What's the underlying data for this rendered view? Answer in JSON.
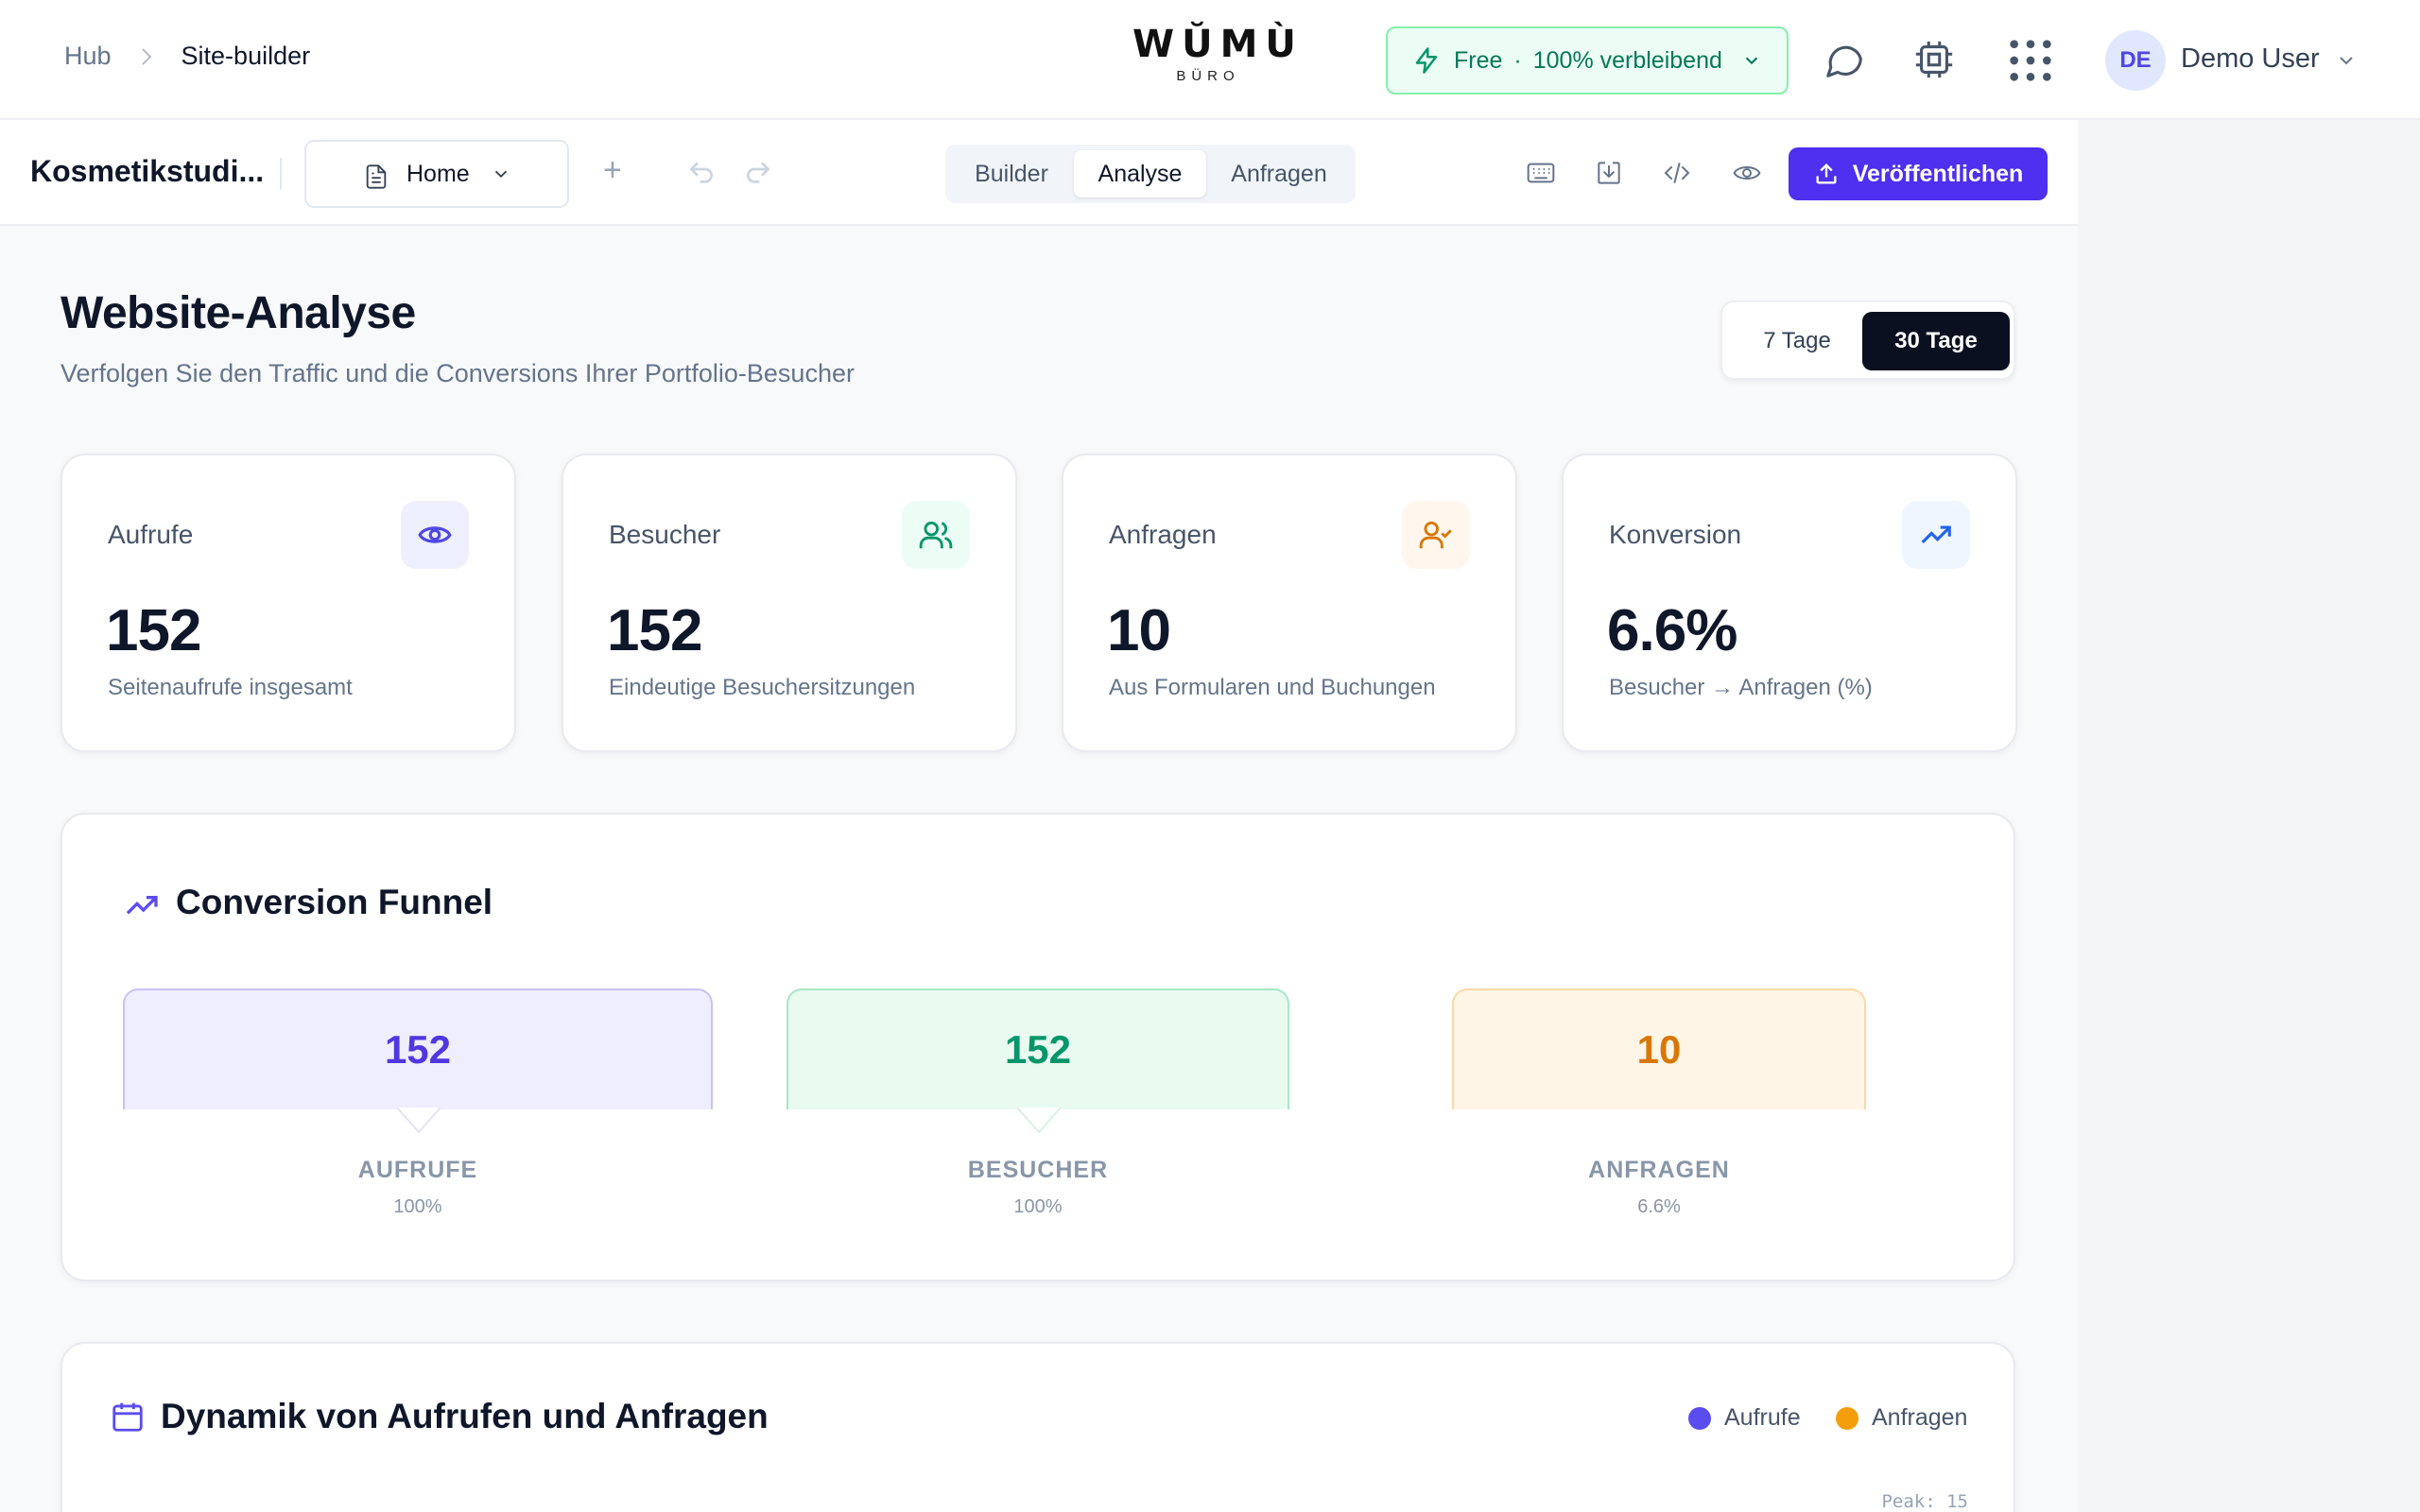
{
  "header": {
    "breadcrumb": {
      "root": "Hub",
      "current": "Site-builder"
    },
    "logo": {
      "main": "WŬMÙ",
      "sub": "BÜRO"
    },
    "plan": {
      "name": "Free",
      "separator": "·",
      "status": "100% verbleibend"
    },
    "user": {
      "initials": "DE",
      "name": "Demo User"
    }
  },
  "toolbar": {
    "project_name": "Kosmetikstudi...",
    "page_select": "Home",
    "add_label": "+",
    "tabs": [
      "Builder",
      "Analyse",
      "Anfragen"
    ],
    "active_tab": "Analyse",
    "publish_label": "Veröffentlichen"
  },
  "main": {
    "title": "Website-Analyse",
    "subtitle": "Verfolgen Sie den Traffic und die Conversions Ihrer Portfolio-Besucher",
    "range": {
      "options": [
        "7 Tage",
        "30 Tage"
      ],
      "selected": "30 Tage"
    },
    "kpis": [
      {
        "label": "Aufrufe",
        "value": "152",
        "desc": "Seitenaufrufe insgesamt",
        "icon": "eye-icon",
        "color": "#4f46e5",
        "bg": "#eef0ff"
      },
      {
        "label": "Besucher",
        "value": "152",
        "desc": "Eindeutige Besuchersitzungen",
        "icon": "users-icon",
        "color": "#059669",
        "bg": "#ecfdf5"
      },
      {
        "label": "Anfragen",
        "value": "10",
        "desc": "Aus Formularen und Buchungen",
        "icon": "user-check-icon",
        "color": "#d97706",
        "bg": "#fff7ed"
      },
      {
        "label": "Konversion",
        "value": "6.6%",
        "desc": "Besucher → Anfragen (%)",
        "icon": "trending-up-icon",
        "color": "#2563eb",
        "bg": "#eff6ff"
      }
    ],
    "funnel": {
      "title": "Conversion Funnel",
      "steps": [
        {
          "value": "152",
          "label": "AUFRUFE",
          "pct": "100%",
          "color": "#4f38e0",
          "bg": "#efeefe",
          "border": "#c7c2f7"
        },
        {
          "value": "152",
          "label": "BESUCHER",
          "pct": "100%",
          "color": "#059669",
          "bg": "#e9faf1",
          "border": "#a7e8c6"
        },
        {
          "value": "10",
          "label": "ANFRAGEN",
          "pct": "6.6%",
          "color": "#d97706",
          "bg": "#fff5e6",
          "border": "#fbd9a6"
        }
      ]
    },
    "dynamics": {
      "title": "Dynamik von Aufrufen und Anfragen",
      "legend": [
        {
          "name": "Aufrufe",
          "color": "#5b4cf0"
        },
        {
          "name": "Anfragen",
          "color": "#f59e0b"
        }
      ],
      "peak": "Peak: 15"
    }
  }
}
